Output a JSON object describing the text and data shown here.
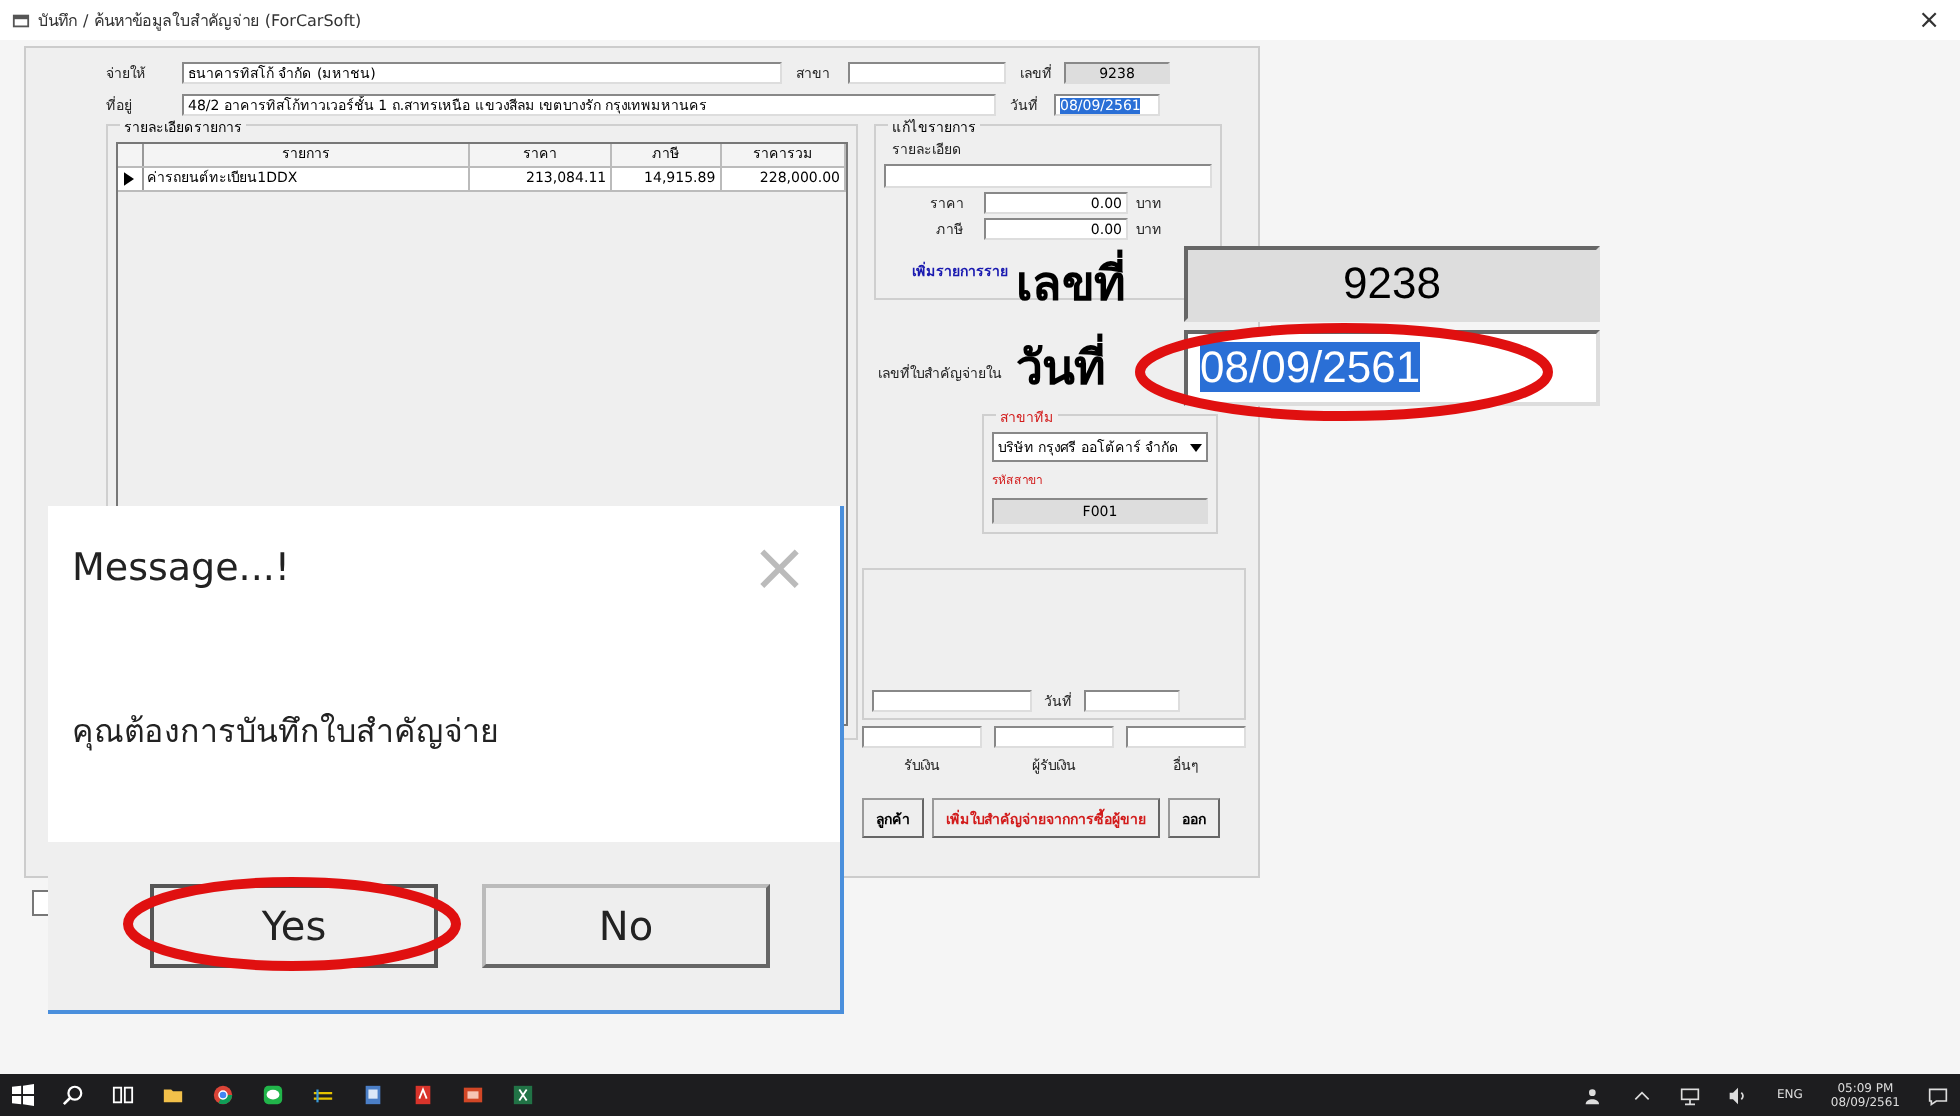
{
  "window": {
    "title": "บันทึก / ค้นหาข้อมูลใบสำคัญจ่าย (ForCarSoft)",
    "close": "×"
  },
  "form": {
    "pay_to": {
      "label": "จ่ายให้",
      "value": "ธนาคารทิสโก้ จำกัด (มหาชน)"
    },
    "branch": {
      "label": "สาขา"
    },
    "number": {
      "label": "เลขที่",
      "value": "9238"
    },
    "address": {
      "label": "ที่อยู่",
      "value": "48/2 อาคารทิสโก้ทาวเวอร์ชั้น 1 ถ.สาทรเหนือ แขวงสีลม เขตบางรัก กรุงเทพมหานคร"
    },
    "date": {
      "label": "วันที่",
      "value": "08/09/2561",
      "selected": true
    },
    "items_group": {
      "title": "รายละเอียดรายการ",
      "columns": [
        "รายการ",
        "ราคา",
        "ภาษี",
        "ราคารวม"
      ],
      "rows": [
        {
          "current": true,
          "cells": [
            "ค่ารถยนต์ทะเบียน1DDX",
            "213,084.11",
            "14,915.89",
            "228,000.00"
          ]
        }
      ]
    },
    "edit_group": {
      "title": "แก้ไขรายการ",
      "detail_label": "รายละเอียด",
      "price_label": "ราคา",
      "price": "0.00",
      "price_unit": "บาท",
      "tax_label": "ภาษี",
      "tax": "0.00",
      "tax_unit": "บาท",
      "add_link": "เพิ่มรายการราย"
    },
    "voucher_label": "เลขที่ใบสำคัญจ่ายใน",
    "checkbox": {
      "checked": false
    },
    "team_group": {
      "title": "สาขาทีม",
      "company": "บริษัท กรุงศรี ออโต้คาร์ จำกัด",
      "code_label": "รหัสสาขา",
      "code": "F001"
    },
    "lower_group": {
      "date_label": "วันที่"
    },
    "signers": [
      "รับเงิน",
      "ผู้รับเงิน",
      "อื่นๆ"
    ],
    "buttons": [
      {
        "label": "ลูกค้า",
        "kind": "normal"
      },
      {
        "label": "เพิ่มใบสำคัญจ่ายจากการซื้อผู้ขาย",
        "kind": "warning"
      },
      {
        "label": "ออก",
        "kind": "normal"
      }
    ]
  },
  "dialog": {
    "title": "Message...!",
    "close": "×",
    "message": "คุณต้องการบันทึกใบสำคัญจ่าย",
    "buttons": [
      {
        "label": "Yes",
        "selected": true
      },
      {
        "label": "No",
        "selected": false
      }
    ]
  },
  "zoom_inset": {
    "number_label": "เลขที่",
    "number": "9238",
    "date_label": "วันที่",
    "date": "08/09/2561"
  },
  "taskbar": {
    "language": "ENG",
    "time": "05:09 PM",
    "date": "08/09/2561"
  }
}
